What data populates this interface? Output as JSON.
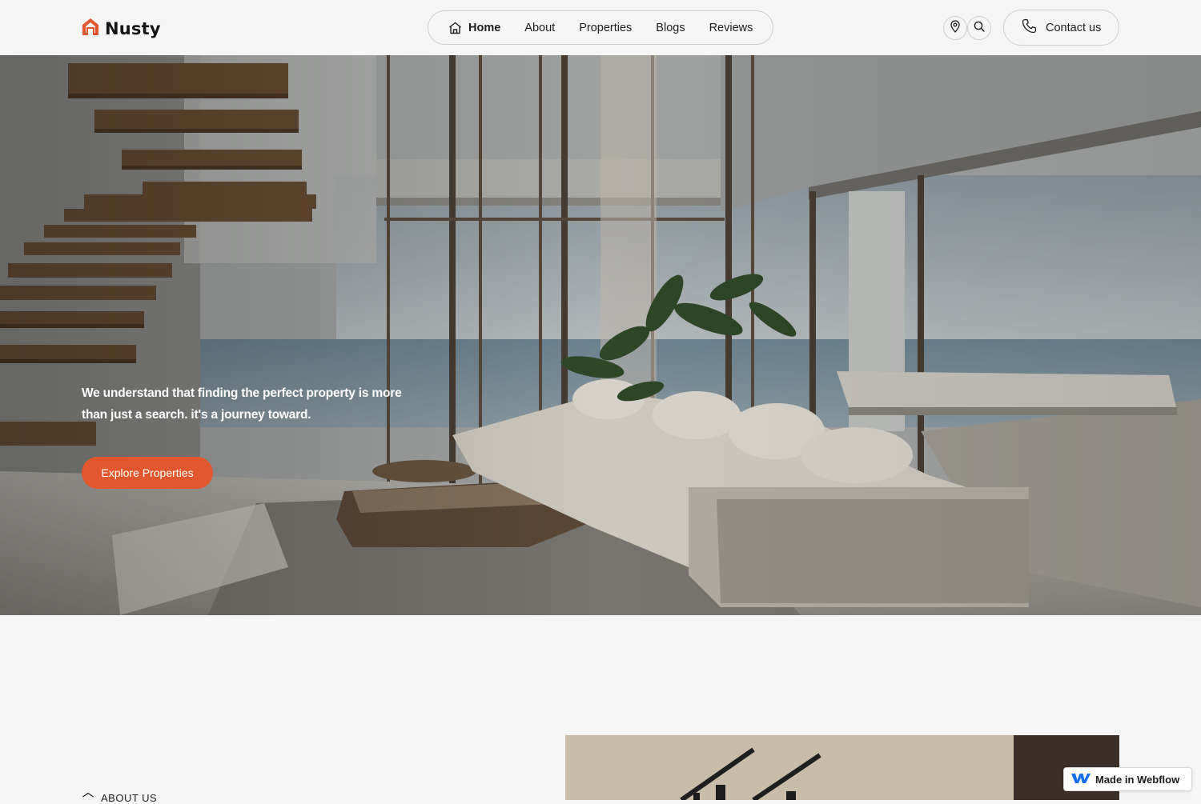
{
  "brand": {
    "name": "Nusty",
    "accent": "#e3572e"
  },
  "nav": {
    "items": [
      {
        "label": "Home",
        "icon": "home-icon",
        "active": true
      },
      {
        "label": "About"
      },
      {
        "label": "Properties"
      },
      {
        "label": "Blogs"
      },
      {
        "label": "Reviews"
      }
    ]
  },
  "header": {
    "location_icon": "map-pin-icon",
    "search_icon": "search-icon",
    "contact_label": "Contact us",
    "contact_icon": "phone-icon"
  },
  "hero": {
    "tagline": "We understand that finding the perfect property is more than just a search. it's a journey toward.",
    "cta_label": "Explore Properties"
  },
  "about": {
    "label": "ABOUT US"
  },
  "badge": {
    "label": "Made in Webflow"
  }
}
